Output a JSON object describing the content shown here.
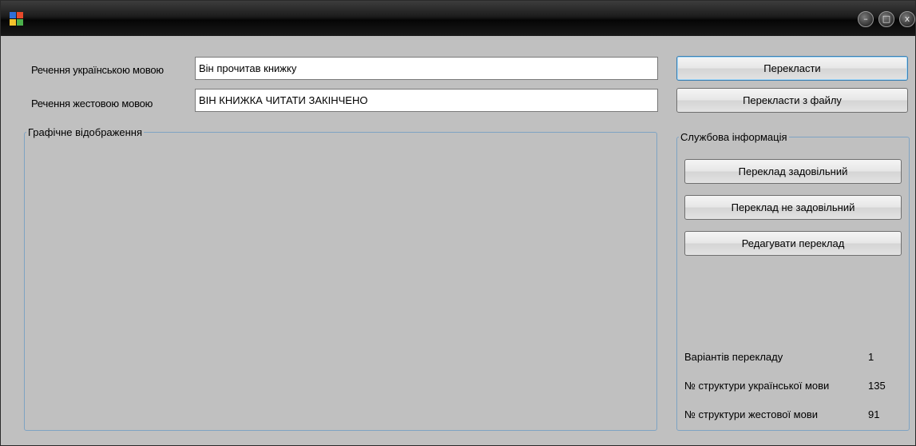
{
  "titlebar": {
    "app_icon": "app-window-icon",
    "controls": {
      "minimize": "–",
      "maximize": "□",
      "close": "x"
    }
  },
  "form": {
    "ukrainian_label": "Речення українською мовою",
    "ukrainian_value": "Він прочитав книжку",
    "sign_label": "Речення жестовою мовою",
    "sign_value": "ВІН КНИЖКА ЧИТАТИ ЗАКІНЧЕНО"
  },
  "buttons": {
    "translate": "Перекласти",
    "translate_file": "Перекласти з файлу"
  },
  "graphic_group": {
    "title": "Графічне відображення"
  },
  "service_group": {
    "title": "Службова інформація",
    "buttons": {
      "satisfactory": "Переклад задовільний",
      "unsatisfactory": "Переклад не задовільний",
      "edit": "Редагувати переклад"
    },
    "stats": [
      {
        "label": "Варіантів перекладу",
        "value": "1"
      },
      {
        "label": "№ структури української мови",
        "value": "135"
      },
      {
        "label": "№ структури жестової мови",
        "value": "91"
      }
    ]
  }
}
